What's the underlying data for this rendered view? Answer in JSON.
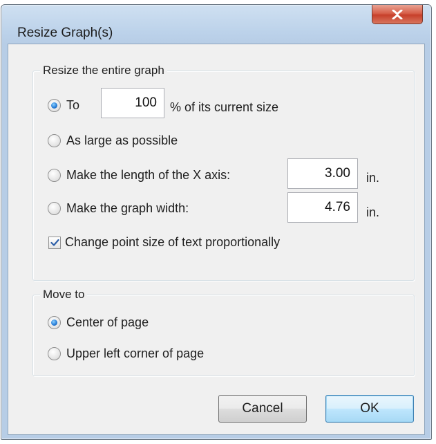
{
  "window": {
    "title": "Resize Graph(s)"
  },
  "resize_group": {
    "title": "Resize the entire graph",
    "option_to_label": "To",
    "percent_value": "100",
    "percent_suffix": "% of its current size",
    "option_largest_label": "As large as possible",
    "option_x_axis_label": "Make the length of the X axis:",
    "x_axis_value": "3.00",
    "x_axis_unit": "in.",
    "option_width_label": "Make the graph width:",
    "width_value": "4.76",
    "width_unit": "in.",
    "selected_option": "To",
    "proportional_text_label": "Change point size of text proportionally",
    "proportional_text_checked": true
  },
  "move_group": {
    "title": "Move to",
    "option_center_label": "Center of page",
    "option_upper_left_label": "Upper left corner of page",
    "selected_option": "Center of page"
  },
  "buttons": {
    "cancel_label": "Cancel",
    "ok_label": "OK"
  },
  "colors": {
    "title_bar": "#bcd2ea",
    "close_button": "#c7402b",
    "dialog_face": "#f0f0f0",
    "radio_selected": "#2a7fd8"
  }
}
